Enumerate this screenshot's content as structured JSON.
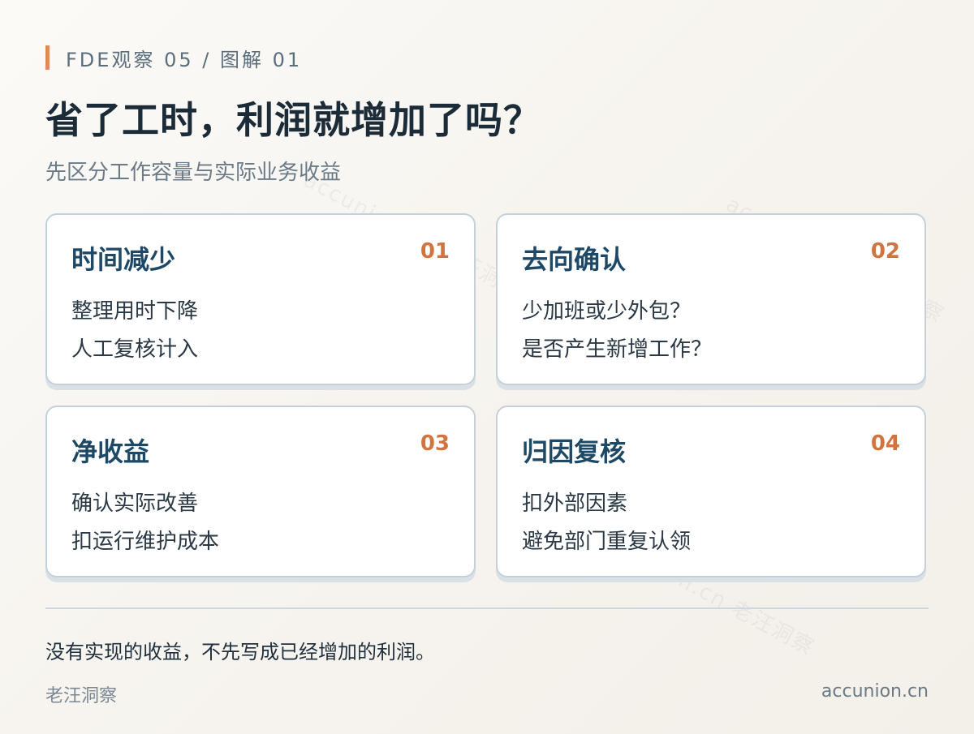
{
  "header": {
    "eyebrow": "FDE观察 05 / 图解 01",
    "title": "省了工时，利润就增加了吗？",
    "subtitle": "先区分工作容量与实际业务收益"
  },
  "cards": [
    {
      "title": "时间减少",
      "number": "01",
      "lines": [
        "整理用时下降",
        "人工复核计入"
      ]
    },
    {
      "title": "去向确认",
      "number": "02",
      "lines": [
        "少加班或少外包？",
        "是否产生新增工作？"
      ]
    },
    {
      "title": "净收益",
      "number": "03",
      "lines": [
        "确认实际改善",
        "扣运行维护成本"
      ]
    },
    {
      "title": "归因复核",
      "number": "04",
      "lines": [
        "扣外部因素",
        "避免部门重复认领"
      ]
    }
  ],
  "footer": {
    "note": "没有实现的收益，不先写成已经增加的利润。",
    "brand": "老汪洞察",
    "site": "accunion.cn"
  },
  "watermark": "accunion.cn 老汪洞察",
  "colors": {
    "accent": "#e08a5a",
    "number": "#d1743f",
    "card_title": "#1d4866",
    "card_border": "#c4d1da"
  }
}
